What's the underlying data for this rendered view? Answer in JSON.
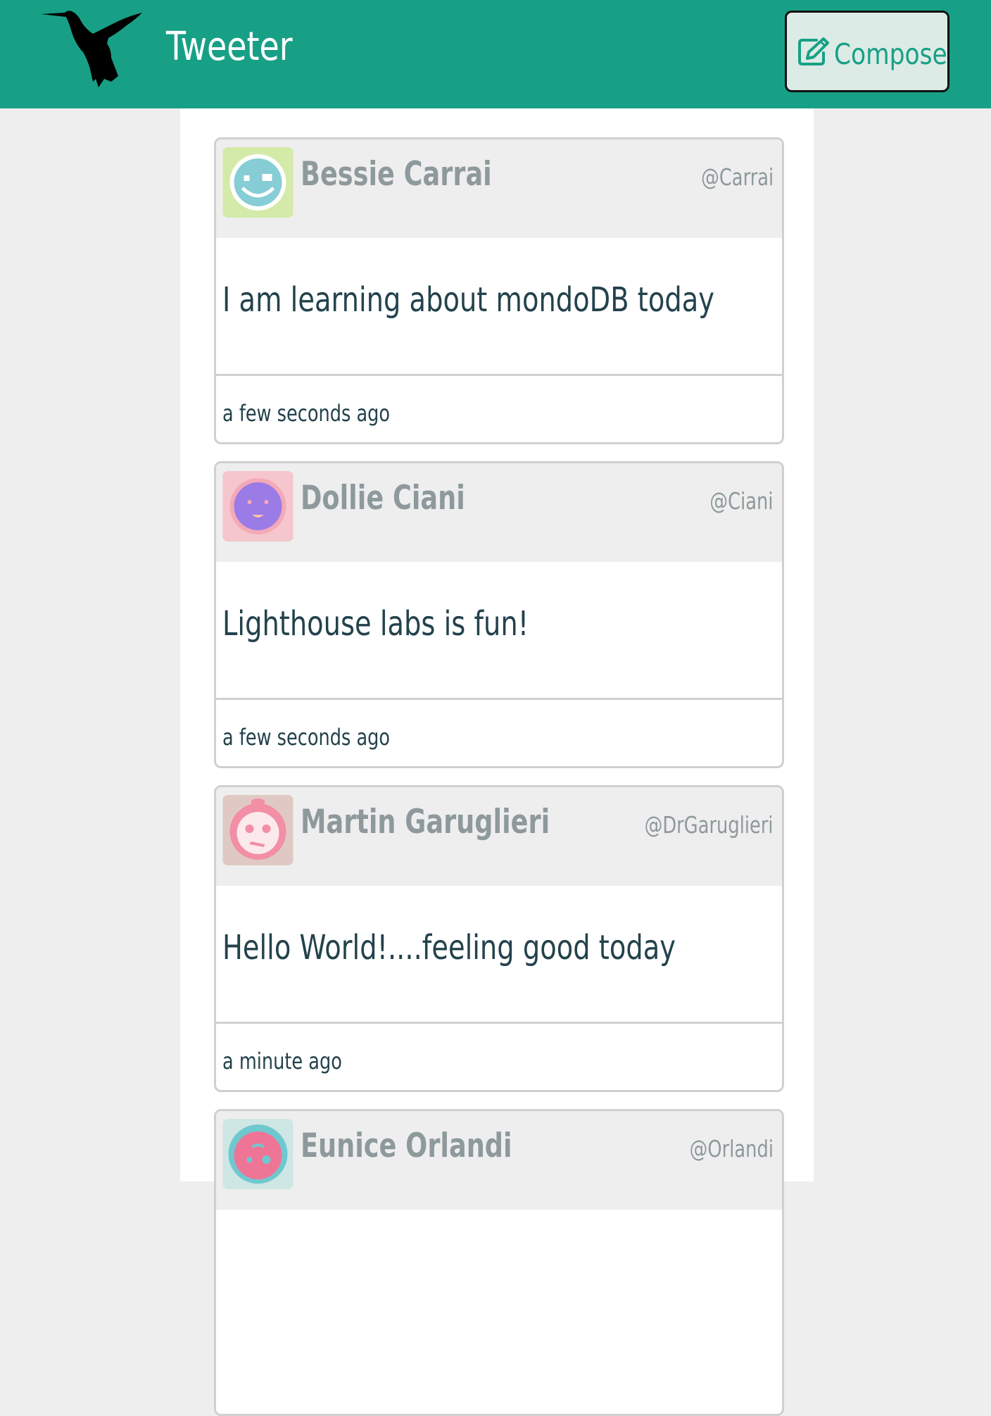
{
  "nav": {
    "brand": "Tweeter",
    "logo_icon": "hummingbird-icon",
    "compose_label": "Compose",
    "compose_icon": "edit-icon"
  },
  "colors": {
    "brand": "#18a086",
    "text": "#23424c",
    "muted": "#8e999c",
    "header_bg": "#eeeeee"
  },
  "tweets": [
    {
      "name": "Bessie Carrai",
      "handle": "@Carrai",
      "content": "I am learning about mondoDB today",
      "time": "a few seconds ago",
      "avatar_icon": "smiley-avatar-icon"
    },
    {
      "name": "Dollie Ciani",
      "handle": "@Ciani",
      "content": "Lighthouse labs is fun!",
      "time": "a few seconds ago",
      "avatar_icon": "smiley-avatar-icon"
    },
    {
      "name": "Martin Garuglieri",
      "handle": "@DrGaruglieri",
      "content": "Hello World!....feeling good today",
      "time": "a minute ago",
      "avatar_icon": "smiley-avatar-icon"
    },
    {
      "name": "Eunice Orlandi",
      "handle": "@Orlandi",
      "avatar_icon": "smiley-avatar-icon"
    }
  ]
}
